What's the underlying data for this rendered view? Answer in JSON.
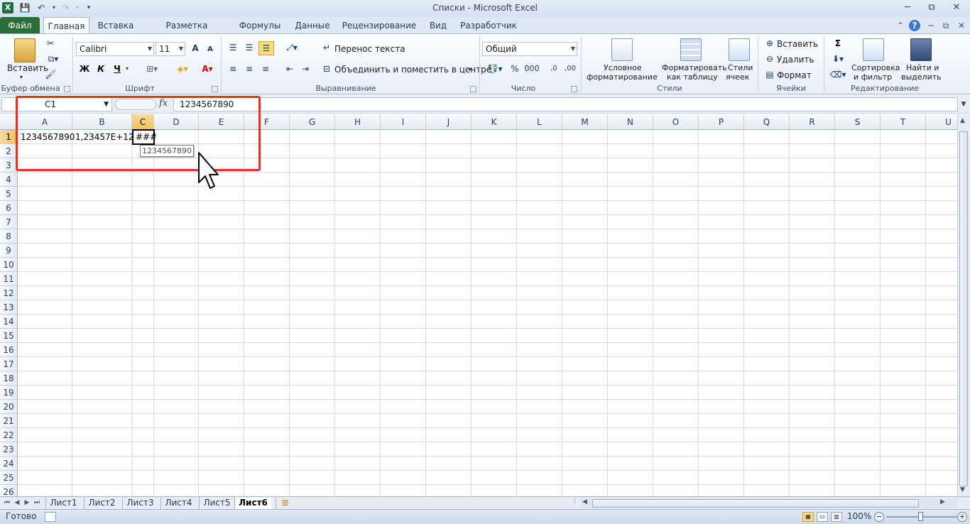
{
  "window": {
    "title": "Списки  -  Microsoft Excel",
    "app_icon": "X",
    "controls": [
      "─",
      "⧉",
      "✕"
    ]
  },
  "quick_access": {
    "save_icon": "💾",
    "undo_icon": "↶",
    "redo_icon": "↷",
    "customize_icon": "▾"
  },
  "ribbon_tabs": [
    "Файл",
    "Главная",
    "Вставка",
    "Разметка страницы",
    "Формулы",
    "Данные",
    "Рецензирование",
    "Вид",
    "Разработчик"
  ],
  "active_tab": "Главная",
  "ribbon": {
    "clipboard": {
      "group": "Буфер обмена",
      "paste": "Вставить"
    },
    "font": {
      "group": "Шрифт",
      "name": "Calibri",
      "size": "11",
      "bold": "Ж",
      "italic": "К",
      "underline": "Ч",
      "grow": "A",
      "shrink": "A"
    },
    "alignment": {
      "group": "Выравнивание",
      "wrap": "Перенос текста",
      "merge": "Объединить и поместить в центре"
    },
    "number": {
      "group": "Число",
      "format": "Общий",
      "percent": "%",
      "thousands": "000",
      "inc_decimal": ",0",
      "dec_decimal": ",00"
    },
    "styles": {
      "group": "Стили",
      "conditional_l1": "Условное",
      "conditional_l2": "форматирование",
      "table_l1": "Форматировать",
      "table_l2": "как таблицу",
      "cell_l1": "Стили",
      "cell_l2": "ячеек"
    },
    "cells": {
      "group": "Ячейки",
      "insert": "Вставить",
      "delete": "Удалить",
      "format": "Формат"
    },
    "editing": {
      "group": "Редактирование",
      "sum": "Σ",
      "sort_l1": "Сортировка",
      "sort_l2": "и фильтр",
      "find_l1": "Найти и",
      "find_l2": "выделить"
    }
  },
  "formula_bar": {
    "name_box": "C1",
    "fx": "fx",
    "content": "1234567890"
  },
  "columns": [
    "A",
    "B",
    "C",
    "D",
    "E",
    "F",
    "G",
    "H",
    "I",
    "J",
    "K",
    "L",
    "M",
    "N",
    "O",
    "P",
    "Q",
    "R",
    "S",
    "T",
    "U"
  ],
  "selected_column": "C",
  "rows": [
    "1",
    "2",
    "3",
    "4",
    "5",
    "6",
    "7",
    "8",
    "9",
    "10",
    "11",
    "12",
    "13",
    "14",
    "15",
    "16",
    "17",
    "18",
    "19",
    "20",
    "21",
    "22",
    "23",
    "24",
    "25",
    "26"
  ],
  "cells": {
    "A1": "1234567890",
    "B1": "1,23457E+12",
    "C1": "###"
  },
  "tooltip": "1234567890",
  "sheets": [
    "Лист1",
    "Лист2",
    "Лист3",
    "Лист4",
    "Лист5",
    "Лист6"
  ],
  "active_sheet": "Лист6",
  "status": {
    "text": "Готово",
    "zoom": "100%"
  },
  "colors": {
    "accent_highlight": "#e8321f",
    "file_tab": "#2a6e3a",
    "selected_header": "#f1c15f"
  }
}
